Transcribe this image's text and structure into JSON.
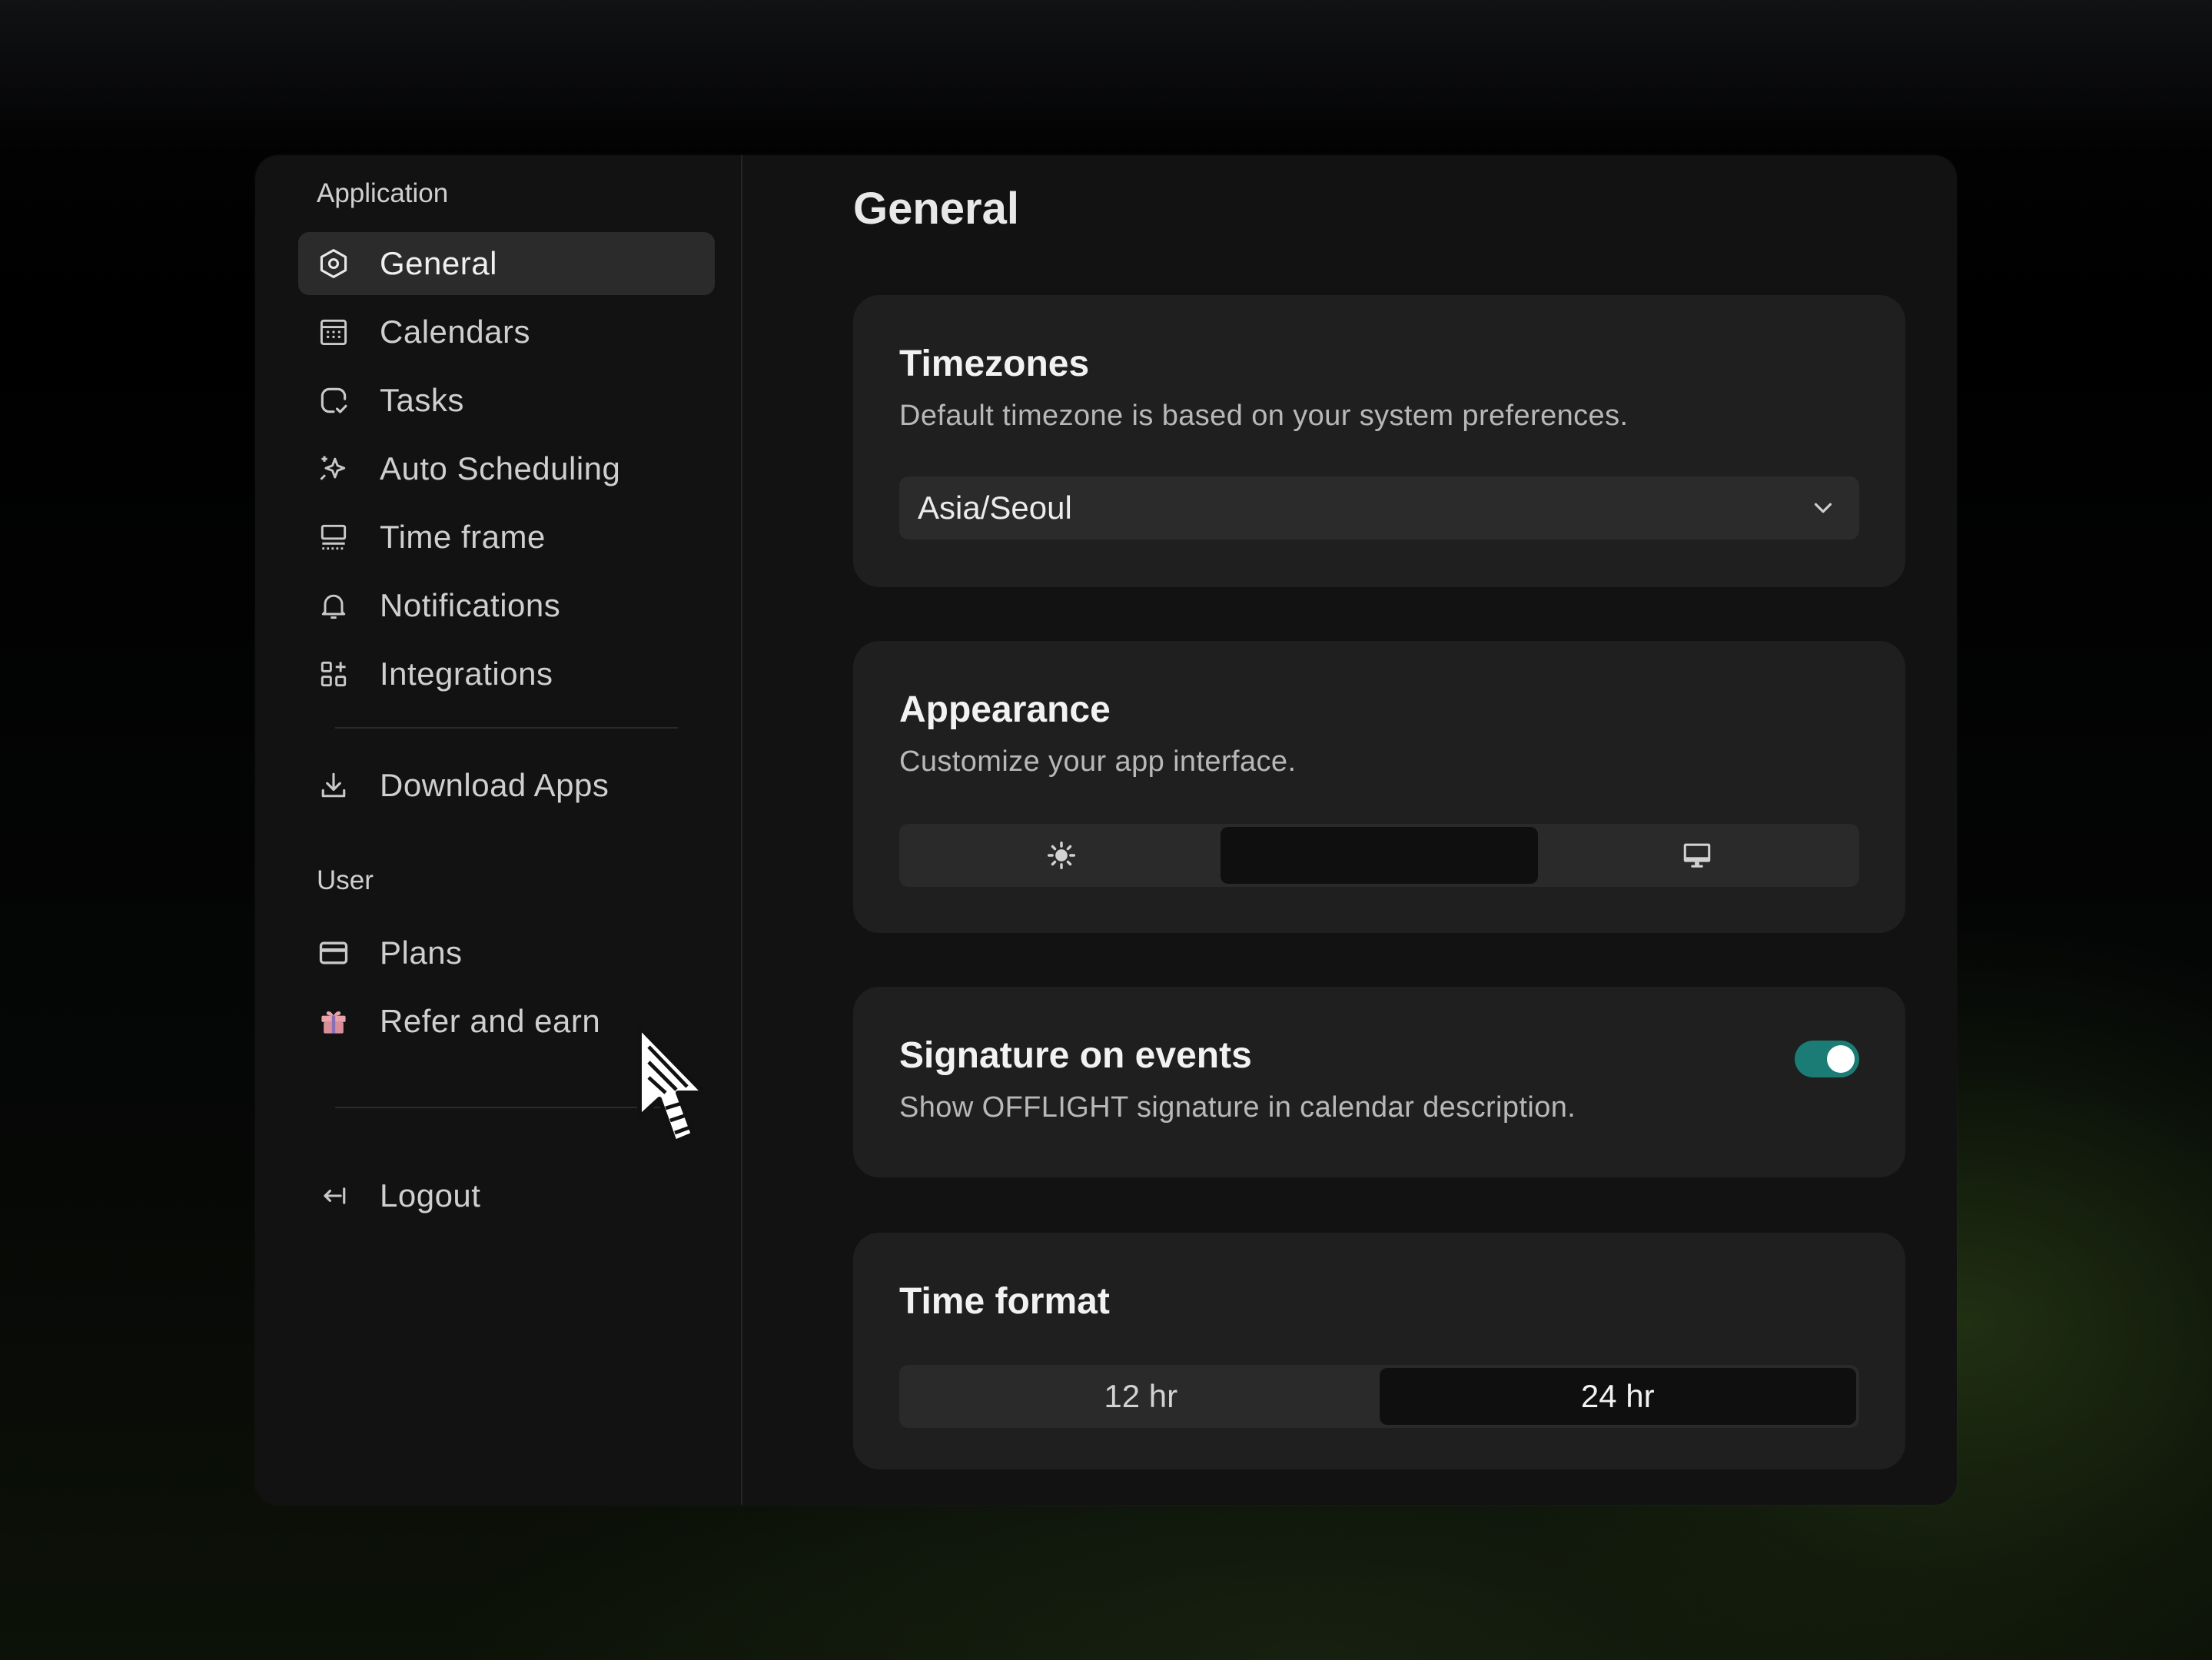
{
  "sidebar": {
    "application_label": "Application",
    "items": [
      {
        "label": "General",
        "icon": "hexagon-settings-icon"
      },
      {
        "label": "Calendars",
        "icon": "calendar-icon"
      },
      {
        "label": "Tasks",
        "icon": "task-check-icon"
      },
      {
        "label": "Auto Scheduling",
        "icon": "sparkles-icon"
      },
      {
        "label": "Time frame",
        "icon": "time-frame-icon"
      },
      {
        "label": "Notifications",
        "icon": "bell-icon"
      },
      {
        "label": "Integrations",
        "icon": "grid-plus-icon"
      }
    ],
    "download_label": "Download Apps",
    "user_label": "User",
    "user_items": [
      {
        "label": "Plans",
        "icon": "credit-card-icon"
      },
      {
        "label": "Refer and earn",
        "icon": "gift-icon"
      }
    ],
    "logout_label": "Logout",
    "active_item": "General"
  },
  "main": {
    "title": "General",
    "timezones": {
      "title": "Timezones",
      "description": "Default timezone is based on your system preferences.",
      "value": "Asia/Seoul"
    },
    "appearance": {
      "title": "Appearance",
      "description": "Customize your app interface.",
      "options": [
        "light-sun-icon",
        "dark-moon-icon",
        "system-monitor-icon"
      ],
      "selected": "dark"
    },
    "signature": {
      "title": "Signature on events",
      "description": "Show OFFLIGHT signature in calendar description.",
      "enabled": true
    },
    "time_format": {
      "title": "Time format",
      "options": [
        "12 hr",
        "24 hr"
      ],
      "selected": "24 hr"
    }
  },
  "colors": {
    "toggle_on": "#1a7c74",
    "gift_icon": "#e8a0a8"
  }
}
